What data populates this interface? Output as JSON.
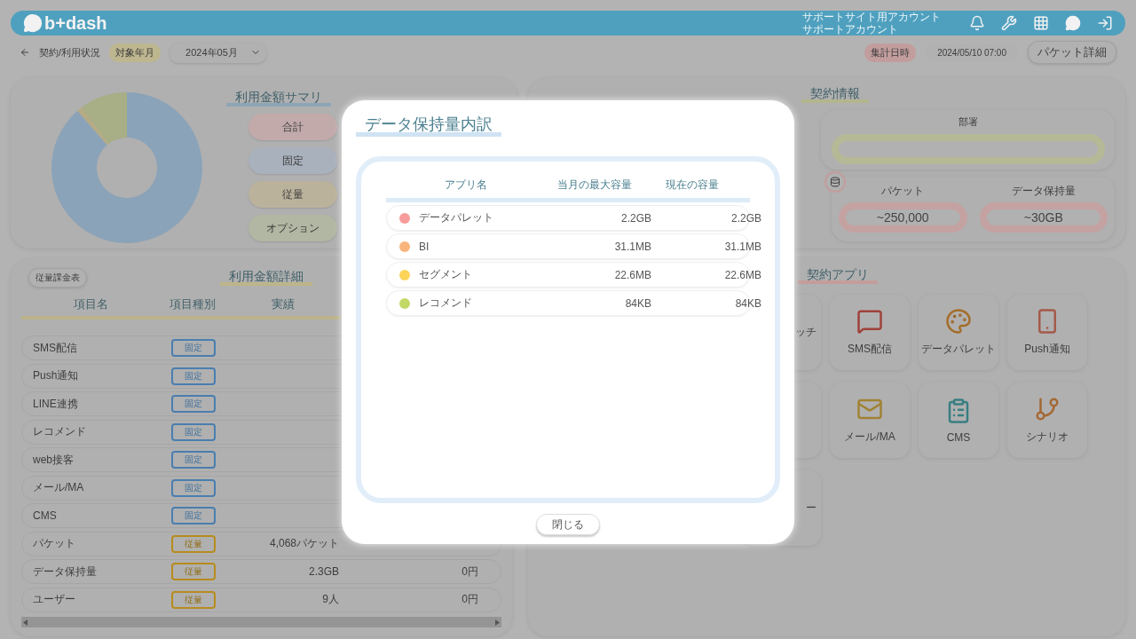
{
  "header": {
    "logo": "b+dash",
    "account_lines": [
      "サポートサイト用アカウント",
      "サポートアカウント"
    ]
  },
  "subbar": {
    "title": "契約/利用状況",
    "period_label": "対象年月",
    "period_value": "2024年05月",
    "aggregated_label": "集計日時",
    "aggregated_value": "2024/05/10 07:00",
    "detail_button": "パケット詳細"
  },
  "summary": {
    "title": "利用金額サマリ",
    "legend": [
      {
        "label": "合計",
        "color": "#c2aaaa"
      },
      {
        "label": "固定",
        "color": "#a9b1bd"
      },
      {
        "label": "従量",
        "color": "#bbb29c"
      },
      {
        "label": "オプション",
        "color": "#b2b7a3"
      }
    ]
  },
  "detail": {
    "rate_button": "従量課金表",
    "title": "利用金額詳細",
    "columns": [
      "項目名",
      "項目種別",
      "実績"
    ],
    "rows": [
      {
        "name": "SMS配信",
        "kind": "fixed",
        "type_label": "固定"
      },
      {
        "name": "Push通知",
        "kind": "fixed",
        "type_label": "固定"
      },
      {
        "name": "LINE連携",
        "kind": "fixed",
        "type_label": "固定"
      },
      {
        "name": "レコメンド",
        "kind": "fixed",
        "type_label": "固定"
      },
      {
        "name": "web接客",
        "kind": "fixed",
        "type_label": "固定"
      },
      {
        "name": "メール/MA",
        "kind": "fixed",
        "type_label": "固定"
      },
      {
        "name": "CMS",
        "kind": "fixed",
        "type_label": "固定"
      },
      {
        "name": "パケット",
        "kind": "metered",
        "type_label": "従量",
        "actual": "4,068パケット"
      },
      {
        "name": "データ保持量",
        "kind": "metered",
        "type_label": "従量",
        "actual": "2.3GB",
        "amount": "0円"
      },
      {
        "name": "ユーザー",
        "kind": "metered",
        "type_label": "従量",
        "actual": "9人",
        "amount": "0円"
      }
    ]
  },
  "contract": {
    "title": "契約情報",
    "department_label": "部署",
    "usage": [
      {
        "label": "パケット",
        "value": "~250,000"
      },
      {
        "label": "データ保持量",
        "value": "~30GB"
      }
    ]
  },
  "apps": {
    "title": "契約アプリ",
    "tiles": [
      {
        "kind": "partial",
        "label": "ッチ"
      },
      {
        "kind": "sms",
        "label": "SMS配信"
      },
      {
        "kind": "palette",
        "label": "データパレット"
      },
      {
        "kind": "push",
        "label": "Push通知"
      },
      {
        "kind": "partial"
      },
      {
        "kind": "mail",
        "label": "メール/MA"
      },
      {
        "kind": "cms",
        "label": "CMS"
      },
      {
        "kind": "scenario",
        "label": "シナリオ"
      },
      {
        "kind": "partial",
        "label": "ー"
      }
    ]
  },
  "modal": {
    "title": "データ保持量内訳",
    "columns": [
      "アプリ名",
      "当月の最大容量",
      "現在の容量"
    ],
    "rows": [
      {
        "name": "データパレット",
        "color": "#f79c9a",
        "max": "2.2GB",
        "current": "2.2GB"
      },
      {
        "name": "BI",
        "color": "#f9b47c",
        "max": "31.1MB",
        "current": "31.1MB"
      },
      {
        "name": "セグメント",
        "color": "#fcd45a",
        "max": "22.6MB",
        "current": "22.6MB"
      },
      {
        "name": "レコメンド",
        "color": "#c3d967",
        "max": "84KB",
        "current": "84KB"
      }
    ],
    "close": "閉じる"
  }
}
